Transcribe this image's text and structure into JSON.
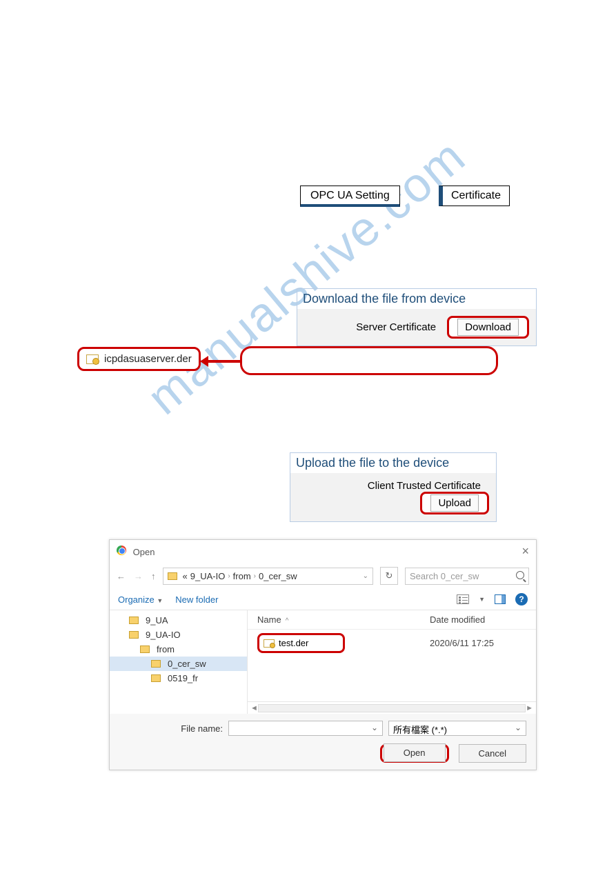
{
  "watermark": "manualshive.com",
  "buttons": {
    "opc_ua": "OPC UA Setting",
    "certificate": "Certificate"
  },
  "download_panel": {
    "title": "Download the file from device",
    "label": "Server Certificate",
    "button": "Download"
  },
  "downloaded_file": "icpdasuaserver.der",
  "upload_panel": {
    "title": "Upload the file to the device",
    "label": "Client Trusted Certificate",
    "button": "Upload"
  },
  "file_dialog": {
    "title": "Open",
    "path_prefix": "«",
    "path_parts": [
      "9_UA-IO",
      "from",
      "0_cer_sw"
    ],
    "search_placeholder": "Search 0_cer_sw",
    "toolbar": {
      "organize": "Organize",
      "new_folder": "New folder"
    },
    "tree": [
      {
        "level": 1,
        "name": "9_UA"
      },
      {
        "level": 1,
        "name": "9_UA-IO"
      },
      {
        "level": 2,
        "name": "from"
      },
      {
        "level": 3,
        "name": "0_cer_sw",
        "selected": true
      },
      {
        "level": 3,
        "name": "0519_fr"
      }
    ],
    "columns": {
      "name": "Name",
      "date": "Date modified"
    },
    "rows": [
      {
        "name": "test.der",
        "date": "2020/6/11 17:25"
      }
    ],
    "footer": {
      "file_name_label": "File name:",
      "type_filter": "所有檔案 (*.*)",
      "open": "Open",
      "cancel": "Cancel"
    }
  }
}
